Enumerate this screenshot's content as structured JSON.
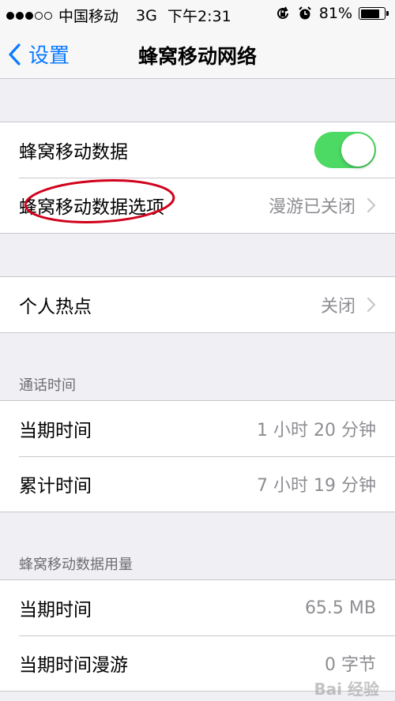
{
  "status_bar": {
    "carrier": "中国移动",
    "network": "3G",
    "time": "下午2:31",
    "battery": "81%",
    "battery_level": 0.81
  },
  "nav": {
    "back_label": "设置",
    "title": "蜂窝移动网络"
  },
  "cellular": {
    "data_label": "蜂窝移动数据",
    "data_enabled": true,
    "options_label": "蜂窝移动数据选项",
    "options_value": "漫游已关闭"
  },
  "hotspot": {
    "label": "个人热点",
    "value": "关闭"
  },
  "call_time": {
    "header": "通话时间",
    "rows": [
      {
        "label": "当期时间",
        "value": "1 小时 20 分钟"
      },
      {
        "label": "累计时间",
        "value": "7 小时 19 分钟"
      }
    ]
  },
  "data_usage": {
    "header": "蜂窝移动数据用量",
    "rows": [
      {
        "label": "当期时间",
        "value": "65.5 MB"
      },
      {
        "label": "当期时间漫游",
        "value": "0 字节"
      }
    ]
  },
  "colors": {
    "accent": "#0a7aff",
    "toggle_on": "#4cd964",
    "annotation": "#d0021b"
  },
  "watermark": "Bai 经验"
}
